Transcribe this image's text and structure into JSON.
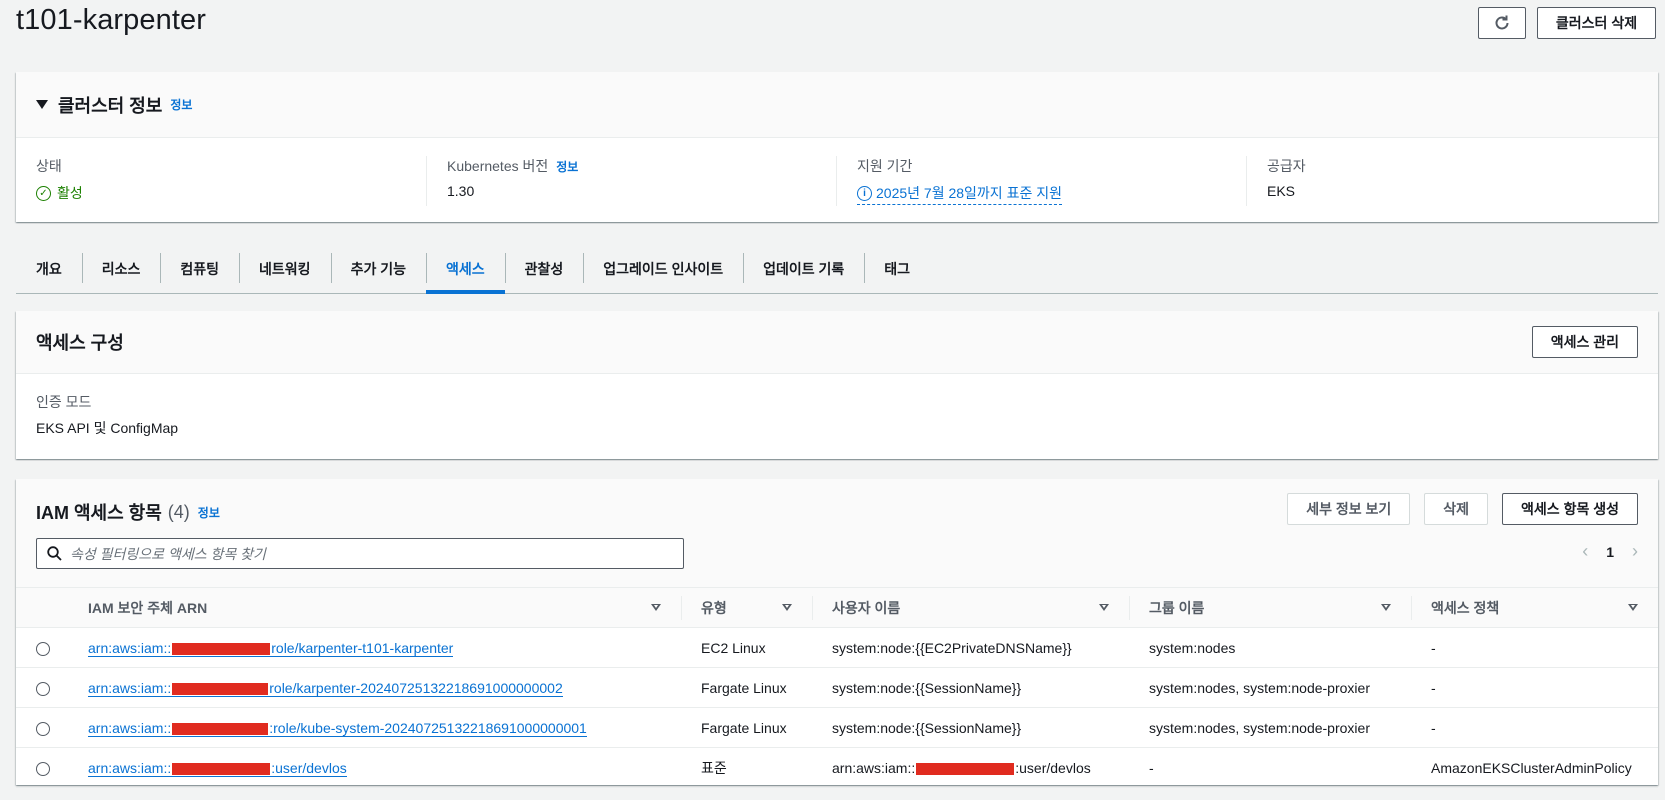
{
  "header": {
    "title": "t101-karpenter",
    "refresh_icon": "refresh-icon",
    "delete_label": "클러스터 삭제"
  },
  "cluster_info": {
    "title": "클러스터 정보",
    "info_link": "정보",
    "status": {
      "label": "상태",
      "value": "활성",
      "icon": "check-circle-icon",
      "color": "#1d8102"
    },
    "k8s_version": {
      "label": "Kubernetes 버전",
      "info_link": "정보",
      "value": "1.30"
    },
    "support": {
      "label": "지원 기간",
      "value": "2025년 7월 28일까지 표준 지원",
      "icon": "info-circle-icon"
    },
    "provider": {
      "label": "공급자",
      "value": "EKS"
    }
  },
  "tabs": [
    {
      "label": "개요"
    },
    {
      "label": "리소스"
    },
    {
      "label": "컴퓨팅"
    },
    {
      "label": "네트워킹"
    },
    {
      "label": "추가 기능"
    },
    {
      "label": "액세스",
      "active": true
    },
    {
      "label": "관찰성"
    },
    {
      "label": "업그레이드 인사이트"
    },
    {
      "label": "업데이트 기록"
    },
    {
      "label": "태그"
    }
  ],
  "access_config": {
    "title": "액세스 구성",
    "manage_label": "액세스 관리",
    "auth_mode_label": "인증 모드",
    "auth_mode_value": "EKS API 및 ConfigMap"
  },
  "iam": {
    "title": "IAM 액세스 항목",
    "count": "(4)",
    "info_link": "정보",
    "view_details_label": "세부 정보 보기",
    "delete_label": "삭제",
    "create_label": "액세스 항목 생성",
    "search_placeholder": "속성 필터링으로 액세스 항목 찾기",
    "page": "1",
    "columns": [
      "IAM 보안 주체 ARN",
      "유형",
      "사용자 이름",
      "그룹 이름",
      "액세스 정책"
    ],
    "rows": [
      {
        "arn_prefix": "arn:aws:iam::",
        "arn_suffix": "role/karpenter-t101-karpenter",
        "type": "EC2 Linux",
        "username": "system:node:{{EC2PrivateDNSName}}",
        "groups": "system:nodes",
        "policy": "-"
      },
      {
        "arn_prefix": "arn:aws:iam::",
        "arn_suffix": "role/karpenter-20240725132218691000000002",
        "type": "Fargate Linux",
        "username": "system:node:{{SessionName}}",
        "groups": "system:nodes, system:node-proxier",
        "policy": "-"
      },
      {
        "arn_prefix": "arn:aws:iam::",
        "arn_suffix": ":role/kube-system-20240725132218691000000001",
        "type": "Fargate Linux",
        "username": "system:node:{{SessionName}}",
        "groups": "system:nodes, system:node-proxier",
        "policy": "-"
      },
      {
        "arn_prefix": "arn:aws:iam::",
        "arn_suffix": ":user/devlos",
        "type": "표준",
        "username_prefix": "arn:aws:iam::",
        "username_suffix": ":user/devlos",
        "groups": "-",
        "policy": "AmazonEKSClusterAdminPolicy"
      }
    ]
  }
}
